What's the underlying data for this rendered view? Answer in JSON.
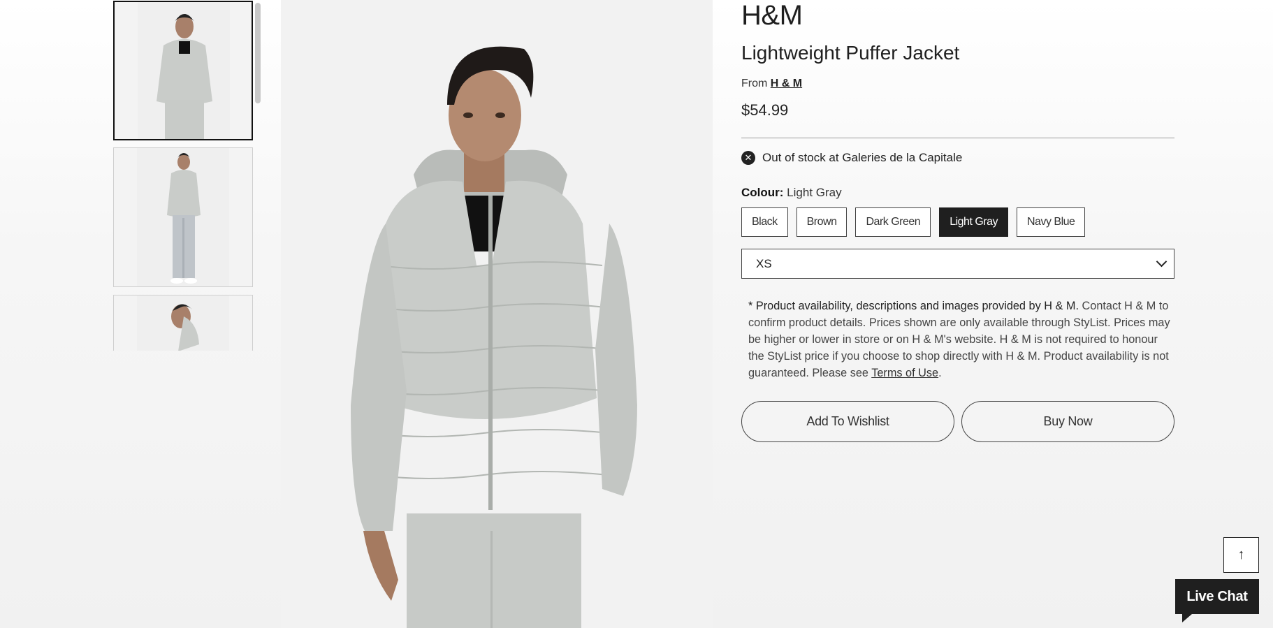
{
  "thumbnails": [
    {
      "alt": "Front view thumbnail",
      "active": true
    },
    {
      "alt": "Full body thumbnail",
      "active": false
    },
    {
      "alt": "Side view thumbnail",
      "active": false
    }
  ],
  "product": {
    "brand": "H&M",
    "title": "Lightweight Puffer Jacket",
    "from_prefix": "From",
    "from_store": "H & M",
    "price": "$54.99",
    "stock_status": "Out of stock at Galeries de la Capitale",
    "colour_label": "Colour:",
    "colour_selected": "Light Gray",
    "colours": [
      "Black",
      "Brown",
      "Dark Green",
      "Light Gray",
      "Navy Blue"
    ],
    "size_selected": "XS"
  },
  "disclaimer": {
    "strong": "* Product availability, descriptions and images provided by H & M.",
    "body": " Contact H & M to confirm product details. Prices shown are only available through StyList. Prices may be higher or lower in store or on H & M's website. H & M is not required to honour the StyList price if you choose to shop directly with H & M. Product availability is not guaranteed. Please see ",
    "link": "Terms of Use",
    "end": "."
  },
  "actions": {
    "wishlist": "Add To Wishlist",
    "buy": "Buy Now"
  },
  "floating": {
    "to_top_icon": "↑",
    "live_chat": "Live Chat"
  },
  "colors": {
    "selected_swatch_bg": "#1f1f1f",
    "jacket": "#c9ccc9"
  }
}
